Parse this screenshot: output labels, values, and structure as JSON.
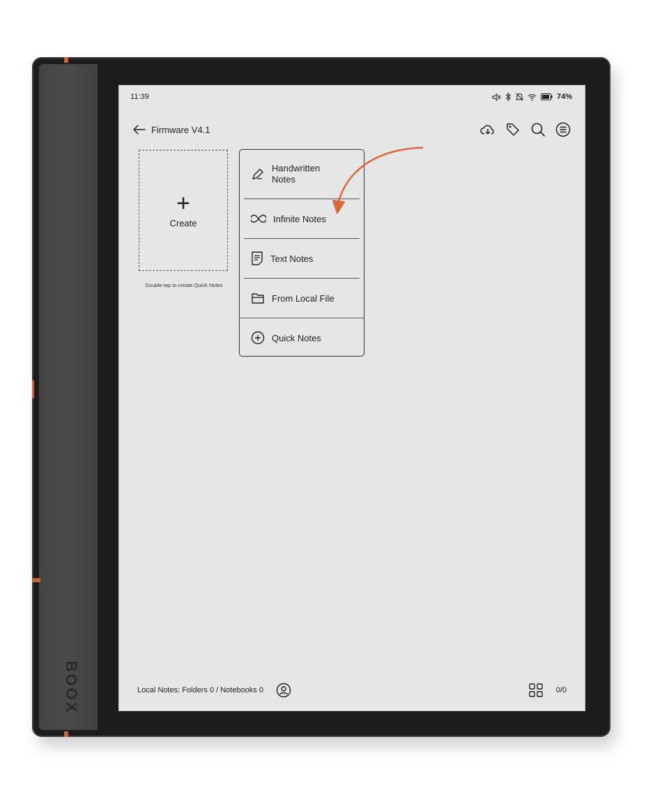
{
  "device": {
    "brand": "BOOX"
  },
  "status_bar": {
    "time": "11:39",
    "battery": "74%"
  },
  "toolbar": {
    "title": "Firmware V4.1"
  },
  "create_tile": {
    "label": "Create",
    "hint": "Double-tap to create Quick Notes"
  },
  "menu": {
    "items": [
      {
        "label": "Handwritten\nNotes",
        "icon": "pen-icon"
      },
      {
        "label": "Infinite Notes",
        "icon": "infinity-icon"
      },
      {
        "label": "Text Notes",
        "icon": "document-icon"
      },
      {
        "label": "From Local File",
        "icon": "folder-icon"
      },
      {
        "label": "Quick Notes",
        "icon": "plus-circle-icon"
      }
    ]
  },
  "footer": {
    "summary": "Local Notes: Folders 0 / Notebooks 0",
    "page_counter": "0/0"
  },
  "colors": {
    "accent": "#c8643a",
    "screen": "#e6e6e6",
    "bezel": "#1c1c1c"
  }
}
